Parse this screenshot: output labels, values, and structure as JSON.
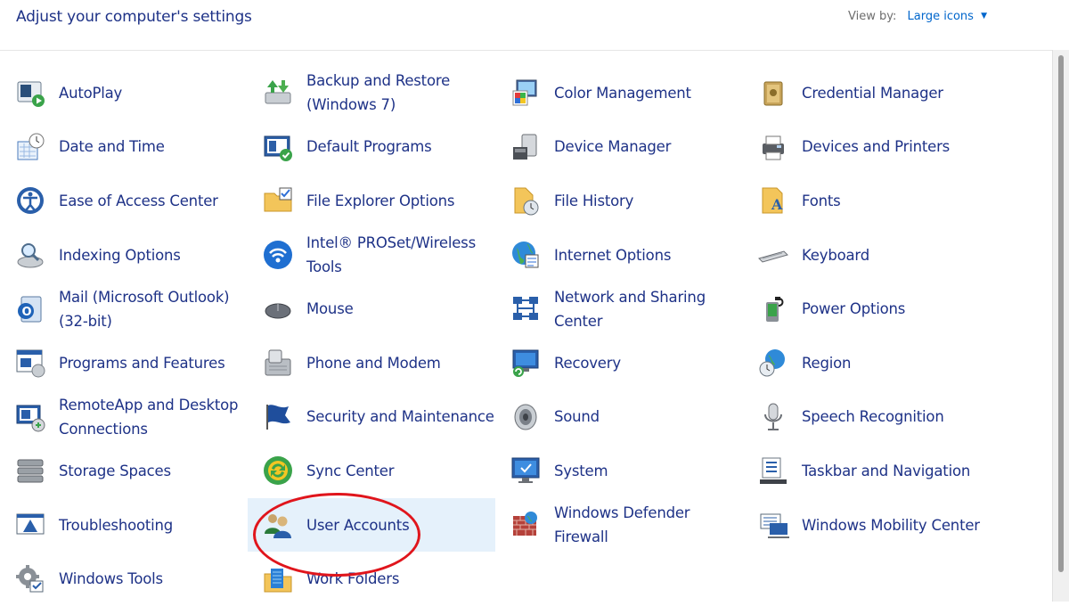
{
  "header": {
    "title": "Adjust your computer's settings",
    "view_by_label": "View by:",
    "view_by_value": "Large icons"
  },
  "items": [
    {
      "label": "AutoPlay",
      "icon": "autoplay-icon"
    },
    {
      "label": "Backup and Restore\n(Windows 7)",
      "icon": "backup-restore-icon"
    },
    {
      "label": "Color Management",
      "icon": "color-management-icon"
    },
    {
      "label": "Credential Manager",
      "icon": "credential-manager-icon"
    },
    {
      "label": "Date and Time",
      "icon": "date-time-icon"
    },
    {
      "label": "Default Programs",
      "icon": "default-programs-icon"
    },
    {
      "label": "Device Manager",
      "icon": "device-manager-icon"
    },
    {
      "label": "Devices and Printers",
      "icon": "devices-printers-icon"
    },
    {
      "label": "Ease of Access Center",
      "icon": "ease-of-access-icon"
    },
    {
      "label": "File Explorer Options",
      "icon": "file-explorer-options-icon"
    },
    {
      "label": "File History",
      "icon": "file-history-icon"
    },
    {
      "label": "Fonts",
      "icon": "fonts-icon"
    },
    {
      "label": "Indexing Options",
      "icon": "indexing-options-icon"
    },
    {
      "label": "Intel® PROSet/Wireless\nTools",
      "icon": "wireless-icon"
    },
    {
      "label": "Internet Options",
      "icon": "internet-options-icon"
    },
    {
      "label": "Keyboard",
      "icon": "keyboard-icon"
    },
    {
      "label": "Mail (Microsoft Outlook)\n(32-bit)",
      "icon": "mail-icon"
    },
    {
      "label": "Mouse",
      "icon": "mouse-icon"
    },
    {
      "label": "Network and Sharing\nCenter",
      "icon": "network-sharing-icon"
    },
    {
      "label": "Power Options",
      "icon": "power-options-icon"
    },
    {
      "label": "Programs and Features",
      "icon": "programs-features-icon"
    },
    {
      "label": "Phone and Modem",
      "icon": "phone-modem-icon"
    },
    {
      "label": "Recovery",
      "icon": "recovery-icon"
    },
    {
      "label": "Region",
      "icon": "region-icon"
    },
    {
      "label": "RemoteApp and Desktop\nConnections",
      "icon": "remoteapp-icon"
    },
    {
      "label": "Security and Maintenance",
      "icon": "security-flag-icon"
    },
    {
      "label": "Sound",
      "icon": "sound-icon"
    },
    {
      "label": "Speech Recognition",
      "icon": "microphone-icon"
    },
    {
      "label": "Storage Spaces",
      "icon": "storage-spaces-icon"
    },
    {
      "label": "Sync Center",
      "icon": "sync-center-icon"
    },
    {
      "label": "System",
      "icon": "system-icon"
    },
    {
      "label": "Taskbar and Navigation",
      "icon": "taskbar-icon"
    },
    {
      "label": "Troubleshooting",
      "icon": "troubleshooting-icon"
    },
    {
      "label": "User Accounts",
      "icon": "user-accounts-icon",
      "highlighted": true
    },
    {
      "label": "Windows Defender\nFirewall",
      "icon": "firewall-icon"
    },
    {
      "label": "Windows Mobility Center",
      "icon": "mobility-center-icon"
    },
    {
      "label": "Windows Tools",
      "icon": "windows-tools-icon"
    },
    {
      "label": "Work Folders",
      "icon": "work-folders-icon"
    }
  ],
  "colors": {
    "link": "#1e3287",
    "accent": "#0066cc",
    "hover_bg": "#e5f1fb",
    "annotation": "#e0151c"
  }
}
